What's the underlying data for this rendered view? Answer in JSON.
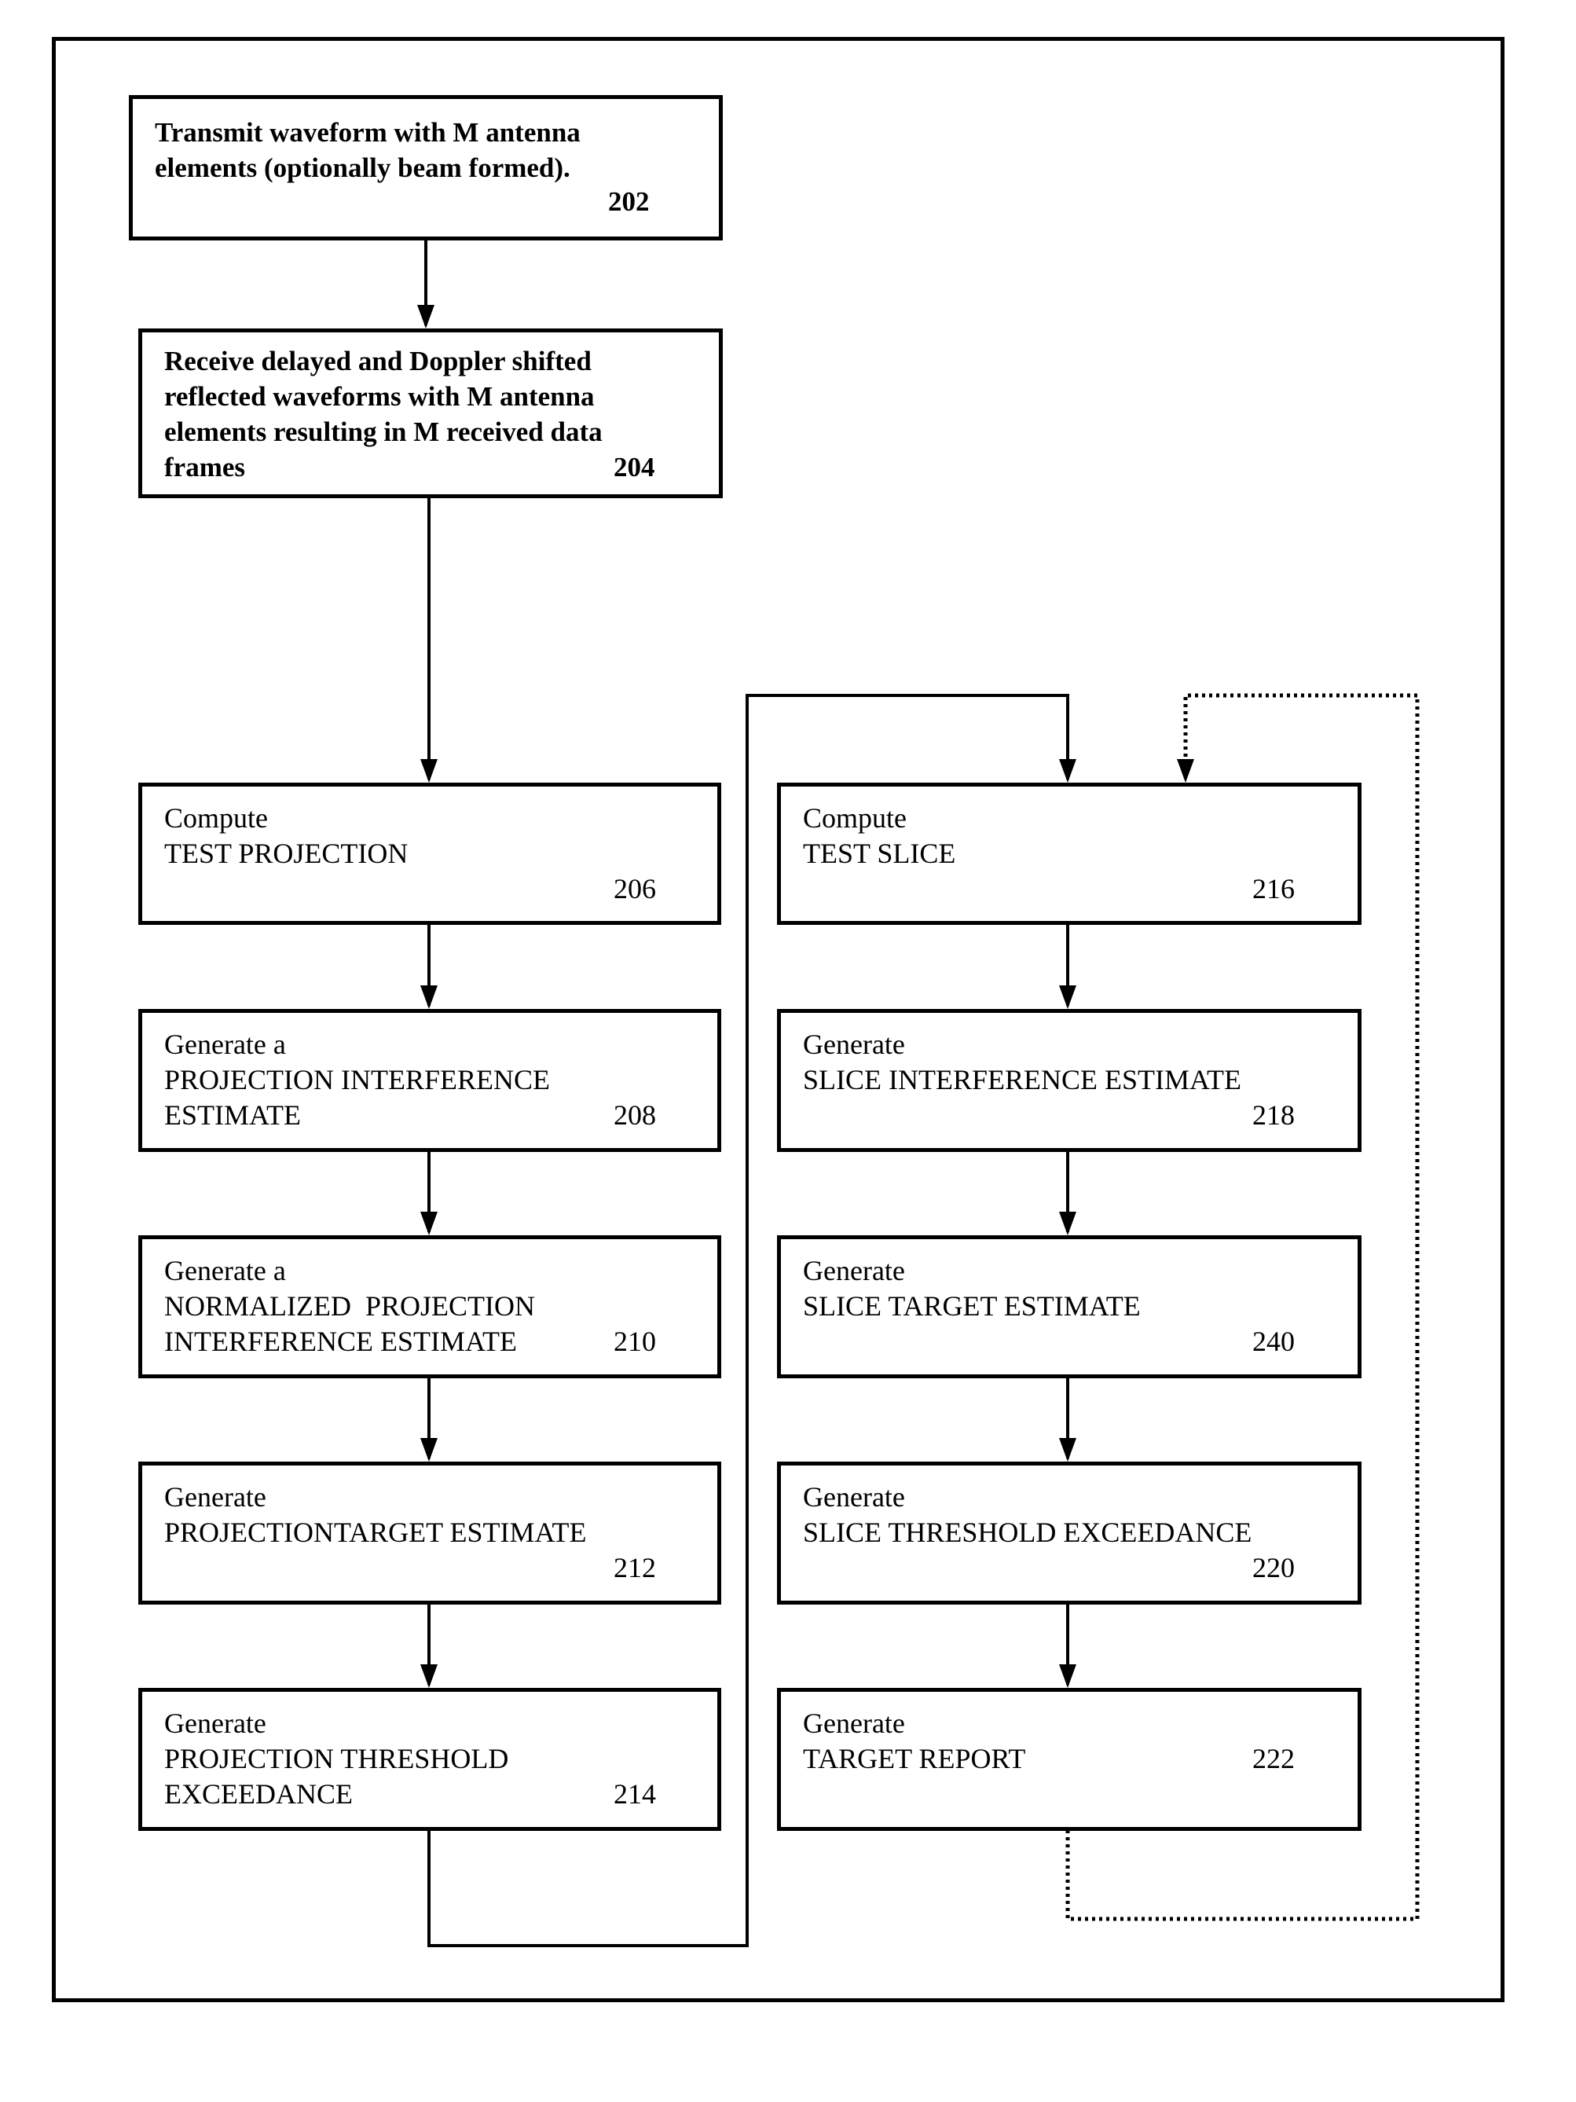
{
  "diagram": {
    "type": "flowchart",
    "boxes": [
      {
        "id": "202",
        "lines": [
          "Transmit waveform with M antenna",
          "elements (optionally beam formed)."
        ],
        "number": "202"
      },
      {
        "id": "204",
        "lines": [
          "Receive delayed and Doppler shifted",
          "reflected waveforms with M antenna",
          "elements resulting in M received data",
          "frames"
        ],
        "number": "204"
      },
      {
        "id": "206",
        "lines": [
          "Compute",
          "TEST PROJECTION"
        ],
        "number": "206"
      },
      {
        "id": "208",
        "lines": [
          "Generate a",
          "PROJECTION INTERFERENCE",
          "ESTIMATE"
        ],
        "number": "208"
      },
      {
        "id": "210",
        "lines": [
          "Generate a",
          "NORMALIZED  PROJECTION",
          "INTERFERENCE ESTIMATE"
        ],
        "number": "210"
      },
      {
        "id": "212",
        "lines": [
          "Generate",
          "PROJECTIONTARGET ESTIMATE"
        ],
        "number": "212"
      },
      {
        "id": "214",
        "lines": [
          "Generate",
          "PROJECTION THRESHOLD",
          "EXCEEDANCE"
        ],
        "number": "214"
      },
      {
        "id": "216",
        "lines": [
          "Compute",
          "TEST SLICE"
        ],
        "number": "216"
      },
      {
        "id": "218",
        "lines": [
          "Generate",
          "SLICE INTERFERENCE ESTIMATE"
        ],
        "number": "218"
      },
      {
        "id": "240",
        "lines": [
          "Generate",
          "SLICE TARGET ESTIMATE"
        ],
        "number": "240"
      },
      {
        "id": "220",
        "lines": [
          "Generate",
          "SLICE THRESHOLD EXCEEDANCE"
        ],
        "number": "220"
      },
      {
        "id": "222",
        "lines": [
          "Generate",
          "TARGET REPORT"
        ],
        "number": "222"
      }
    ],
    "edges": [
      {
        "from": "202",
        "to": "204",
        "style": "solid"
      },
      {
        "from": "204",
        "to": "206",
        "style": "solid"
      },
      {
        "from": "206",
        "to": "208",
        "style": "solid"
      },
      {
        "from": "208",
        "to": "210",
        "style": "solid"
      },
      {
        "from": "210",
        "to": "212",
        "style": "solid"
      },
      {
        "from": "212",
        "to": "214",
        "style": "solid"
      },
      {
        "from": "214",
        "to": "216",
        "style": "solid"
      },
      {
        "from": "216",
        "to": "218",
        "style": "solid"
      },
      {
        "from": "218",
        "to": "240",
        "style": "solid"
      },
      {
        "from": "240",
        "to": "220",
        "style": "solid"
      },
      {
        "from": "220",
        "to": "222",
        "style": "solid"
      },
      {
        "from": "222",
        "to": "216",
        "style": "dotted"
      }
    ],
    "colors": {
      "line": "#000000",
      "background": "#ffffff"
    }
  }
}
